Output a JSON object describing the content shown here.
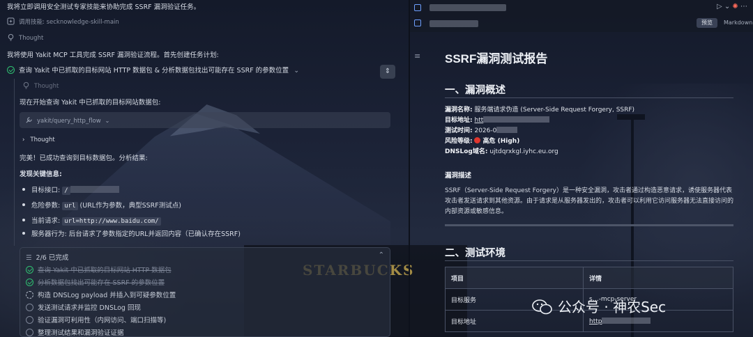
{
  "left": {
    "intro": "我将立即调用安全测试专家技能来协助完成 SSRF 漏洞验证任务。",
    "skill_call": "调用技能: secknowledge-skill-main",
    "thought1": "Thought",
    "plan_text": "我将使用 Yakit MCP 工具完成 SSRF 漏洞验证流程。首先创建任务计划:",
    "task_query": "查询 Yakit 中已抓取的目标网站 HTTP 数据包 & 分析数据包找出可能存在 SSRF 的参数位置",
    "thought2": "Thought",
    "start_query": "现在开始查询 Yakit 中已抓取的目标网站数据包:",
    "tool_name": "yakit/query_http_flow",
    "thought3": "Thought",
    "done_text": "完美！已成功查询到目标数据包。分析结果:",
    "findings_title": "发现关键信息:",
    "findings": [
      {
        "label": "目标接口:",
        "code": "/"
      },
      {
        "label": "危险参数:",
        "code": "url",
        "after": "(URL作为参数，典型SSRF测试点)"
      },
      {
        "label": "当前请求:",
        "code": "url=http://www.baidu.com/"
      },
      {
        "label": "服务器行为:",
        "after": "后台请求了参数指定的URL并返回内容（已确认存在SSRF)"
      }
    ],
    "todo": {
      "progress": "2/6 已完成",
      "items": [
        {
          "label": "查询 Yakit 中已抓取的目标网站 HTTP 数据包",
          "status": "done"
        },
        {
          "label": "分析数据包找出可能存在 SSRF 的参数位置",
          "status": "done"
        },
        {
          "label": "构造 DNSLog payload 并插入到可疑参数位置",
          "status": "in-progress"
        },
        {
          "label": "发送测试请求并监控 DNSLog 回现",
          "status": "pending"
        },
        {
          "label": "验证漏洞可利用性（内网访问、端口扫描等)",
          "status": "pending"
        },
        {
          "label": "整理测试结果和漏洞验证证据",
          "status": "pending"
        }
      ]
    }
  },
  "right": {
    "tabs": {
      "preview": "预览",
      "markdown": "Markdown"
    },
    "title": "SSRF漏洞测试报告",
    "section1": "一、漏洞概述",
    "fields": [
      {
        "key": "漏洞名称:",
        "value": "服务端请求伪造 (Server-Side Request Forgery, SSRF)"
      },
      {
        "key": "目标地址:",
        "value": "htt"
      },
      {
        "key": "测试时间:",
        "value": "2026-0"
      },
      {
        "key": "风险等级:",
        "value": "高危 (High)"
      },
      {
        "key": "DNSLog域名:",
        "value": "ujtdqrxkgl.iyhc.eu.org"
      }
    ],
    "subsection": "漏洞描述",
    "description": "SSRF（Server-Side Request Forgery）是一种安全漏洞，攻击者通过构造恶意请求，诱使服务器代表攻击者发送请求到其他资源。由于请求是从服务器发出的，攻击者可以利用它访问服务器无法直接访问的内部资源或敏感信息。",
    "section2": "二、测试环境",
    "table": {
      "headers": [
        "项目",
        "详情"
      ],
      "rows": [
        [
          "目标服务",
          "s…-mcp-server"
        ],
        [
          "目标地址",
          "http"
        ]
      ]
    }
  },
  "background": {
    "sign": "STARBUCKS"
  },
  "watermark": "公众号 · 神农Sec",
  "colors": {
    "success": "#2fbf71",
    "danger": "#e0362e",
    "accent": "#6ea0ff"
  }
}
